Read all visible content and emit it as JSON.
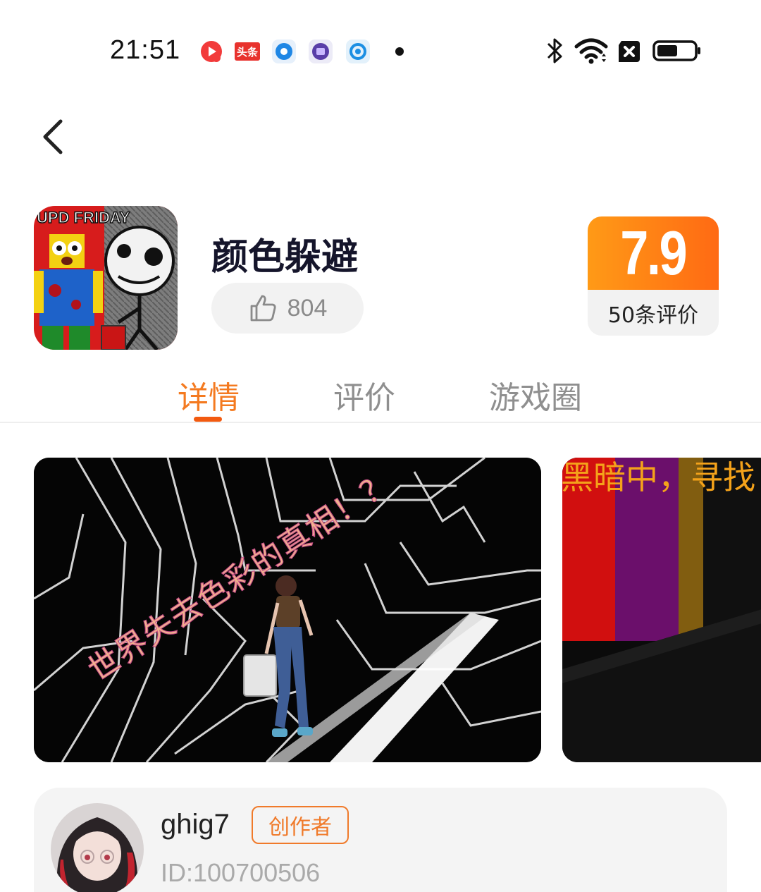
{
  "status_bar": {
    "time": "21:51",
    "notification_icons": [
      "video-app-icon",
      "toutiao-icon",
      "blue-circle-app-icon",
      "purple-app-icon",
      "at-app-icon"
    ],
    "toutiao_label": "头条",
    "system_icons": [
      "bluetooth-icon",
      "wifi-icon",
      "sim-blocked-icon",
      "battery-icon"
    ],
    "battery_level": 0.55
  },
  "header": {
    "back_icon": "chevron-left-icon"
  },
  "app": {
    "icon_text": "UPD FRIDAY",
    "title": "颜色躲避",
    "likes": "804",
    "like_icon": "thumbs-up-icon",
    "score": "7.9",
    "review_count_label": "50条评价"
  },
  "tabs": [
    {
      "label": "详情",
      "active": true
    },
    {
      "label": "评价",
      "active": false
    },
    {
      "label": "游戏圈",
      "active": false
    }
  ],
  "screenshots": [
    {
      "caption": "世界失去色彩的真相！？"
    },
    {
      "caption": "黑暗中，寻找"
    }
  ],
  "creator": {
    "name": "ghig7",
    "badge": "创作者",
    "id_label": "ID:100700506"
  },
  "colors": {
    "accent": "#f47a20",
    "score_gradient_start": "#ff9a16",
    "score_gradient_end": "#ff6a14"
  }
}
